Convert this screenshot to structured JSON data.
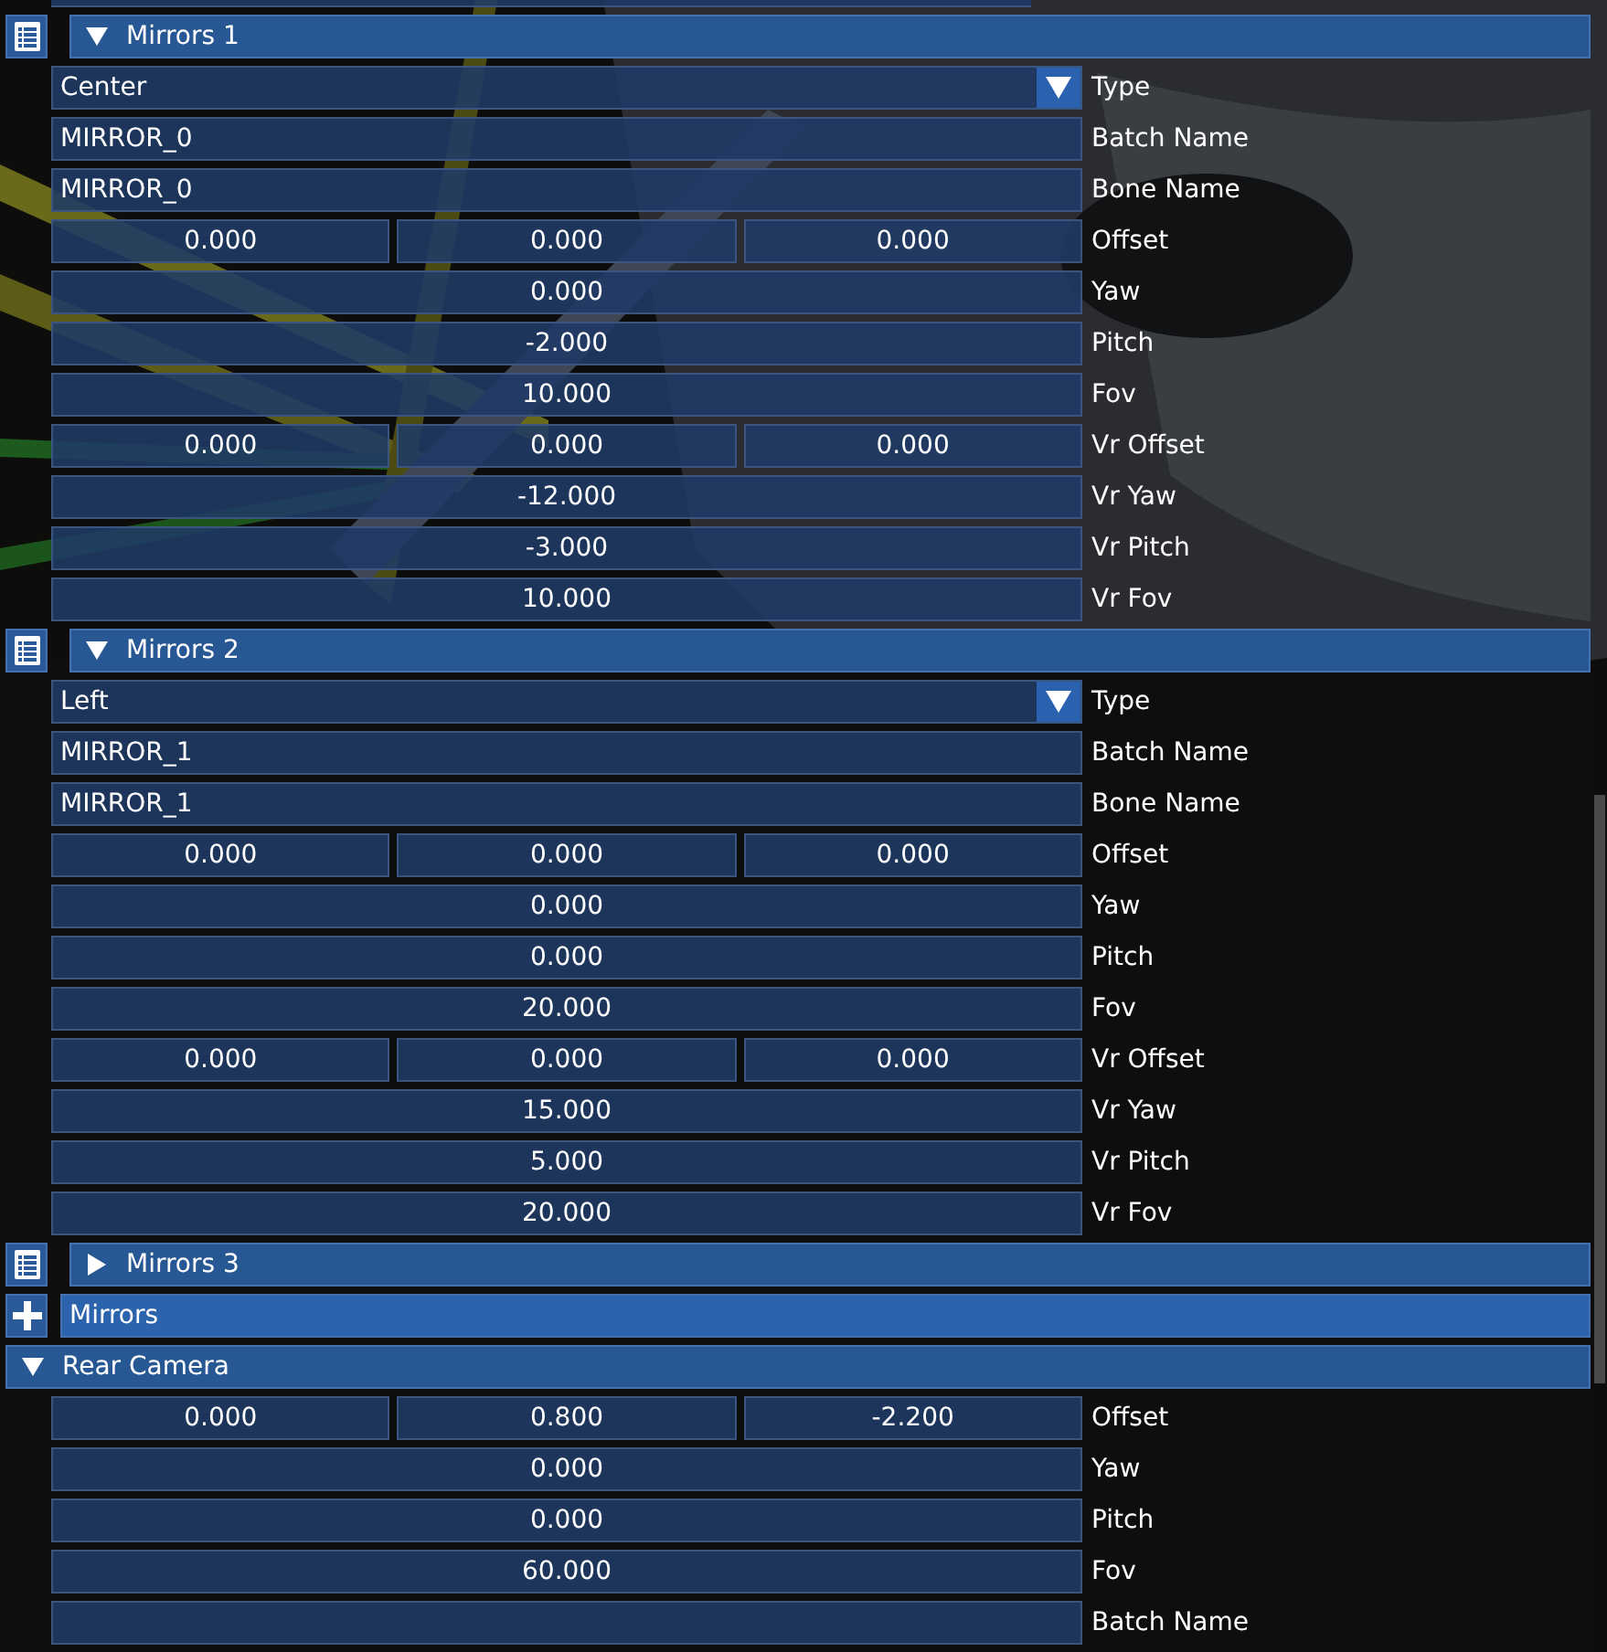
{
  "sections": [
    {
      "kind": "group",
      "title": "Mirrors 1",
      "expanded": true,
      "fields": [
        {
          "kind": "combo",
          "value": "Center",
          "label": "Type"
        },
        {
          "kind": "text",
          "value": "MIRROR_0",
          "label": "Batch Name"
        },
        {
          "kind": "text",
          "value": "MIRROR_0",
          "label": "Bone Name"
        },
        {
          "kind": "vec3",
          "values": [
            "0.000",
            "0.000",
            "0.000"
          ],
          "label": "Offset"
        },
        {
          "kind": "float",
          "value": "0.000",
          "label": "Yaw"
        },
        {
          "kind": "float",
          "value": "-2.000",
          "label": "Pitch"
        },
        {
          "kind": "float",
          "value": "10.000",
          "label": "Fov"
        },
        {
          "kind": "vec3",
          "values": [
            "0.000",
            "0.000",
            "0.000"
          ],
          "label": "Vr Offset"
        },
        {
          "kind": "float",
          "value": "-12.000",
          "label": "Vr Yaw"
        },
        {
          "kind": "float",
          "value": "-3.000",
          "label": "Vr Pitch"
        },
        {
          "kind": "float",
          "value": "10.000",
          "label": "Vr Fov"
        }
      ]
    },
    {
      "kind": "group",
      "title": "Mirrors 2",
      "expanded": true,
      "fields": [
        {
          "kind": "combo",
          "value": "Left",
          "label": "Type"
        },
        {
          "kind": "text",
          "value": "MIRROR_1",
          "label": "Batch Name"
        },
        {
          "kind": "text",
          "value": "MIRROR_1",
          "label": "Bone Name"
        },
        {
          "kind": "vec3",
          "values": [
            "0.000",
            "0.000",
            "0.000"
          ],
          "label": "Offset"
        },
        {
          "kind": "float",
          "value": "0.000",
          "label": "Yaw"
        },
        {
          "kind": "float",
          "value": "0.000",
          "label": "Pitch"
        },
        {
          "kind": "float",
          "value": "20.000",
          "label": "Fov"
        },
        {
          "kind": "vec3",
          "values": [
            "0.000",
            "0.000",
            "0.000"
          ],
          "label": "Vr Offset"
        },
        {
          "kind": "float",
          "value": "15.000",
          "label": "Vr Yaw"
        },
        {
          "kind": "float",
          "value": "5.000",
          "label": "Vr Pitch"
        },
        {
          "kind": "float",
          "value": "20.000",
          "label": "Vr Fov"
        }
      ]
    },
    {
      "kind": "group",
      "title": "Mirrors 3",
      "expanded": false
    },
    {
      "kind": "add",
      "title": "Mirrors"
    },
    {
      "kind": "header",
      "title": "Rear Camera",
      "expanded": true,
      "fields": [
        {
          "kind": "vec3",
          "values": [
            "0.000",
            "0.800",
            "-2.200"
          ],
          "label": "Offset"
        },
        {
          "kind": "float",
          "value": "0.000",
          "label": "Yaw"
        },
        {
          "kind": "float",
          "value": "0.000",
          "label": "Pitch"
        },
        {
          "kind": "float",
          "value": "60.000",
          "label": "Fov"
        },
        {
          "kind": "text",
          "label": "Batch Name"
        }
      ]
    }
  ]
}
